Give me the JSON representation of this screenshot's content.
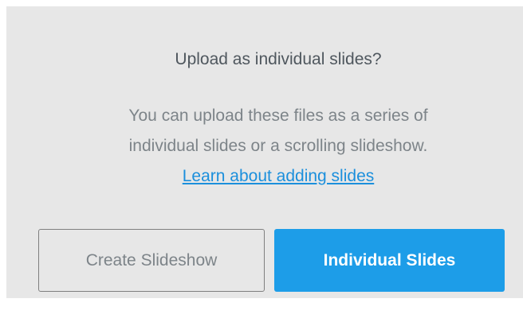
{
  "dialog": {
    "title": "Upload as individual slides?",
    "message_line1": "You can upload these files as a series of",
    "message_line2": "individual slides or a scrolling slideshow.",
    "learn_link": "Learn about adding slides",
    "secondary_button": "Create Slideshow",
    "primary_button": "Individual Slides"
  },
  "colors": {
    "background": "#e7e7e7",
    "primary": "#1d9de8",
    "link": "#1b8fdc"
  }
}
